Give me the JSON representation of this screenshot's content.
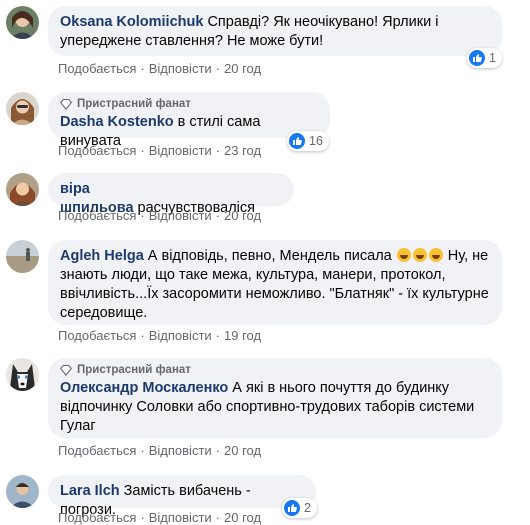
{
  "labels": {
    "like": "Подобається",
    "reply": "Відповісти",
    "sep": "·"
  },
  "badge": {
    "fan": "Пристрасний фанат"
  },
  "comments": [
    {
      "author": "Oksana Kolomiichuk",
      "text": "Справді? Як неочікувано! Ярлики і упереджене ставлення? Не може бути!",
      "time": "20 год",
      "likes": "1"
    },
    {
      "author": "Dasha Kostenko",
      "text": "в стилі сама винувата",
      "time": "23 год",
      "likes": "16",
      "fan": true
    },
    {
      "author": "віра шпильова",
      "text": "расчувствовалiся",
      "time": "20 год"
    },
    {
      "author": "Agleh Helga",
      "text_before": "А відповідь, певно, Мендель писала",
      "emoji": [
        "rofl-emoji",
        "rofl-emoji",
        "rofl-emoji"
      ],
      "text_after": "Ну, не знають люди, що таке межа, культура, манери, протокол, ввічливість...Їх засоромити неможливо. \"Блатняк\" - їх культурне середовище.",
      "time": "19 год"
    },
    {
      "author": "Олександр Москаленко",
      "text": "А які в нього почуття до будинку відпочинку Соловки або спортивно-трудових таборів системи Гулаг",
      "time": "20 год",
      "fan": true
    },
    {
      "author": "Lara Ilch",
      "text": "Замість вибачень - погрози.",
      "time": "20 год",
      "likes": "2"
    }
  ],
  "colors": {
    "author": "#1c3a6e",
    "bubble": "#f0f2f5",
    "meta": "#65676b",
    "like_blue": "#1877f2"
  }
}
